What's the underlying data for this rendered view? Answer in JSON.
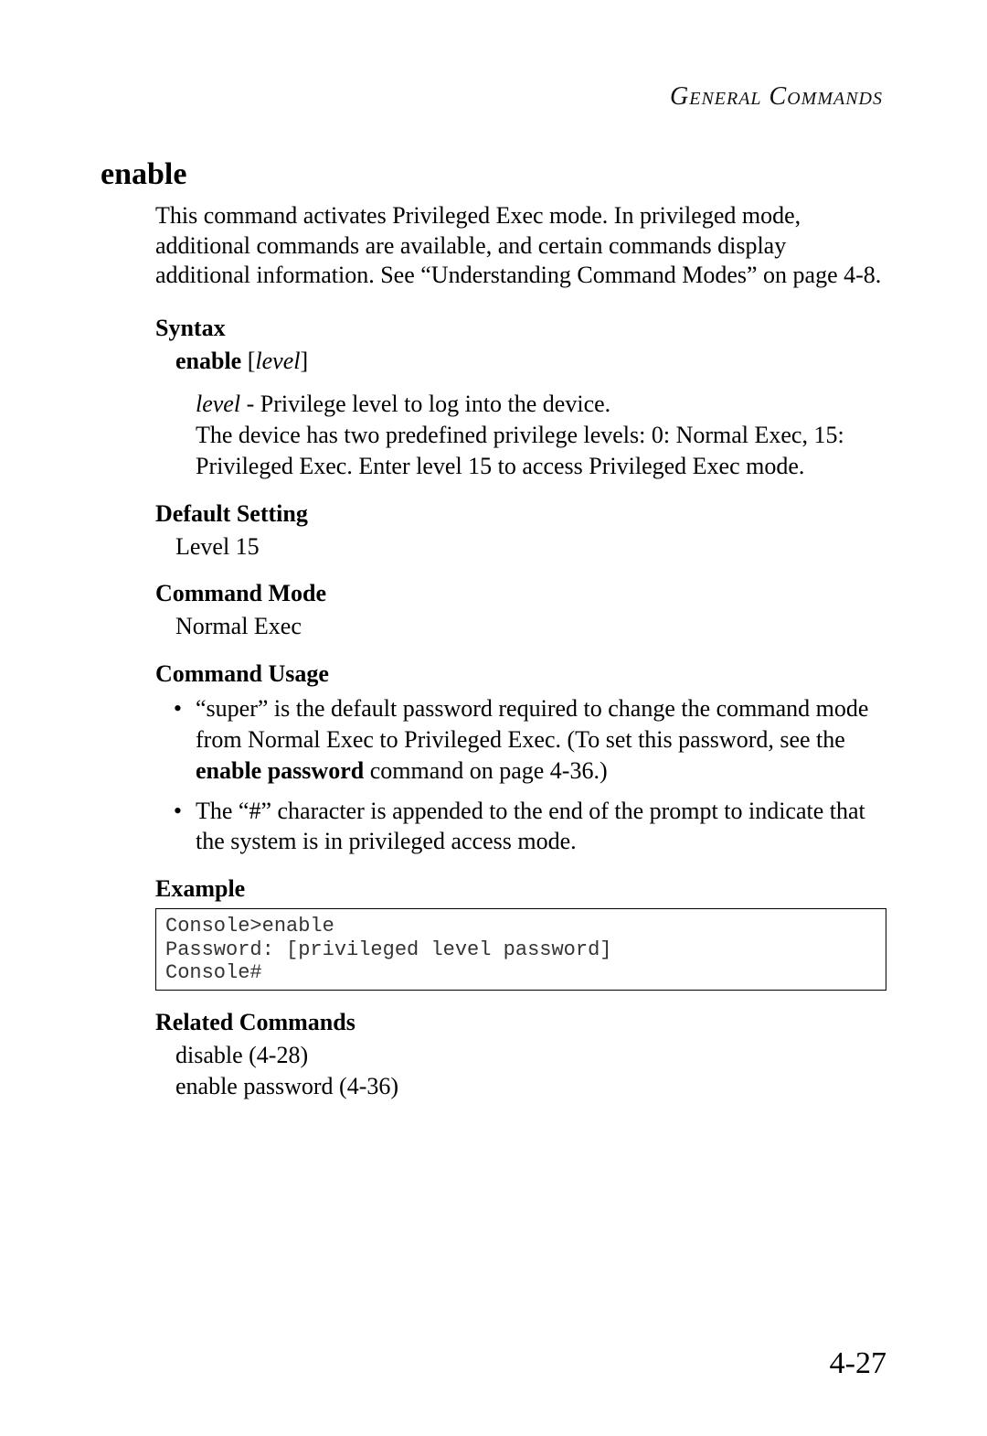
{
  "header": {
    "section_label": "General Commands"
  },
  "command": {
    "name": "enable",
    "description": "This command activates Privileged Exec mode. In privileged mode, additional commands are available, and certain commands display additional information. See “Understanding Command Modes” on page 4-8."
  },
  "syntax": {
    "heading": "Syntax",
    "command_bold": "enable",
    "bracket_open": " [",
    "param_italic": "level",
    "bracket_close": "]",
    "param_name": "level",
    "param_sep": " - ",
    "param_desc_first": "Privilege level to log into the device.",
    "param_desc_rest": "The device has two predefined privilege levels: 0: Normal Exec, 15: Privileged Exec. Enter level 15 to access Privileged Exec mode."
  },
  "default_setting": {
    "heading": "Default Setting",
    "value": "Level 15"
  },
  "command_mode": {
    "heading": "Command Mode",
    "value": "Normal Exec"
  },
  "command_usage": {
    "heading": "Command Usage",
    "items": [
      {
        "pre": "“super” is the default password required to change the command mode from Normal Exec to Privileged Exec. (To set this password, see the ",
        "bold": "enable password",
        "post": " command on page 4-36.)"
      },
      {
        "text": "The “#” character is appended to the end of the prompt to indicate that the system is in privileged access mode."
      }
    ]
  },
  "example": {
    "heading": "Example",
    "code": "Console>enable\nPassword: [privileged level password]\nConsole#"
  },
  "related_commands": {
    "heading": "Related Commands",
    "items": [
      "disable (4-28)",
      "enable password (4-36)"
    ]
  },
  "page_number": "4-27"
}
